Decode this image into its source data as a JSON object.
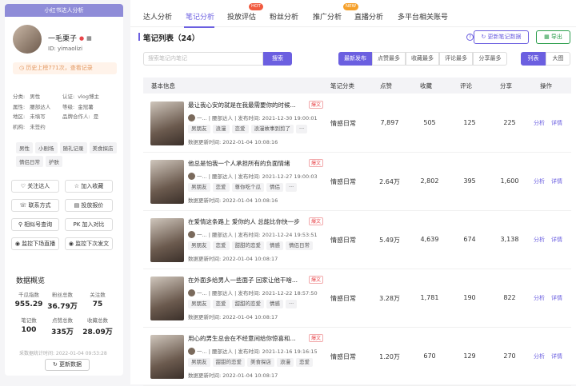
{
  "sidebar": {
    "header": "小红书达人分析",
    "name": "一毛栗子",
    "id_label": "ID: yimaolizi",
    "history": "历史上榜771次，查看记录",
    "info": [
      {
        "k": "分类:",
        "v": "男性"
      },
      {
        "k": "属性:",
        "v": "腰部达人"
      },
      {
        "k": "地区:",
        "v": "未填写"
      },
      {
        "k": "机构:",
        "v": "未签约"
      }
    ],
    "info2": [
      {
        "k": "认证:",
        "v": "vlog博主"
      },
      {
        "k": "等级:",
        "v": "金冠薯"
      },
      {
        "k": "品牌合作人:",
        "v": "是"
      }
    ],
    "tags": [
      "男性",
      "小剧场",
      "随礼记录",
      "美食探店",
      "情侣日常",
      "护肤"
    ],
    "buttons": [
      "关注达人",
      "加入收藏",
      "联系方式",
      "投放报价",
      "相似号查询",
      "加入对比",
      "监控下场直播",
      "监控下次发文"
    ],
    "section_title": "数据概览",
    "stats": [
      {
        "label": "千瓜指数",
        "value": "955.29"
      },
      {
        "label": "粉丝总数",
        "value": "36.79万"
      },
      {
        "label": "关注数",
        "value": "75"
      },
      {
        "label": "笔记数",
        "value": "100"
      },
      {
        "label": "点赞总数",
        "value": "335万"
      },
      {
        "label": "收藏总数",
        "value": "28.09万"
      }
    ],
    "update_time": "采数据统计时间: 2022-01-04 09:53:28",
    "update_btn": "更新数据"
  },
  "tabs": [
    "达人分析",
    "笔记分析",
    "投放评估",
    "粉丝分析",
    "推广分析",
    "直播分析",
    "多平台相关账号"
  ],
  "tab_badges": {
    "hot": "HOT",
    "new": "NEW"
  },
  "list": {
    "title": "笔记列表（24）",
    "refresh": "更新笔记数据",
    "export": "导出",
    "search_placeholder": "搜索笔记内笔记",
    "search_btn": "搜索",
    "sorts": [
      "最新发布",
      "点赞最多",
      "收藏最多",
      "评论最多",
      "分享最多"
    ],
    "views": [
      "列表",
      "大图"
    ],
    "headers": [
      "基本信息",
      "笔记分类",
      "点赞",
      "收藏",
      "评论",
      "分享",
      "操作"
    ],
    "hot_label": "爆文",
    "actions": [
      "分析",
      "详情"
    ],
    "rows": [
      {
        "title": "最让我心安的就是在我最需要你的时候...",
        "meta": "一... | 腰部达人 | 发布时间: 2021-12-30 19:00:01",
        "tags": [
          "男朋友",
          "浪漫",
          "恋爱",
          "浪漫故事到剪了",
          "···"
        ],
        "updated": "数据更新时间: 2022-01-04 10:08:16",
        "category": "情感日常",
        "likes": "7,897",
        "saves": "505",
        "comments": "125",
        "shares": "225"
      },
      {
        "title": "他总是怕我一个人承担所有的负面情绪",
        "meta": "一... | 腰部达人 | 发布时间: 2021-12-27 19:00:03",
        "tags": [
          "男朋友",
          "恋爱",
          "尊你吃个瓜",
          "情侣",
          "···"
        ],
        "updated": "数据更新时间: 2022-01-04 10:08:16",
        "category": "情感日常",
        "likes": "2.64万",
        "saves": "2,802",
        "comments": "395",
        "shares": "1,600"
      },
      {
        "title": "在爱情这条路上 爱你的人 总能比你快一步",
        "meta": "一... | 腰部达人 | 发布时间: 2021-12-24 19:53:51",
        "tags": [
          "男朋友",
          "恋爱",
          "甜甜的恋爱",
          "情感",
          "情侣日常"
        ],
        "updated": "数据更新时间: 2022-01-04 10:08:17",
        "category": "情感日常",
        "likes": "5.49万",
        "saves": "4,639",
        "comments": "674",
        "shares": "3,138"
      },
      {
        "title": "在外面多给男人一些面子 回家让他干啥...",
        "meta": "一... | 腰部达人 | 发布时间: 2021-12-22 18:57:50",
        "tags": [
          "男朋友",
          "恋爱",
          "甜甜的恋爱",
          "情感",
          "···"
        ],
        "updated": "数据更新时间: 2022-01-04 10:08:17",
        "category": "情感日常",
        "likes": "3.28万",
        "saves": "1,781",
        "comments": "190",
        "shares": "822"
      },
      {
        "title": "用心的男生总会在不经意间给你惊喜和...",
        "meta": "一... | 腰部达人 | 发布时间: 2021-12-16 19:16:15",
        "tags": [
          "男朋友",
          "甜甜的恋爱",
          "美食探店",
          "浪漫",
          "恋爱"
        ],
        "updated": "数据更新时间: 2022-01-04 10:08:17",
        "category": "情感日常",
        "likes": "1.20万",
        "saves": "670",
        "comments": "129",
        "shares": "270"
      }
    ]
  }
}
